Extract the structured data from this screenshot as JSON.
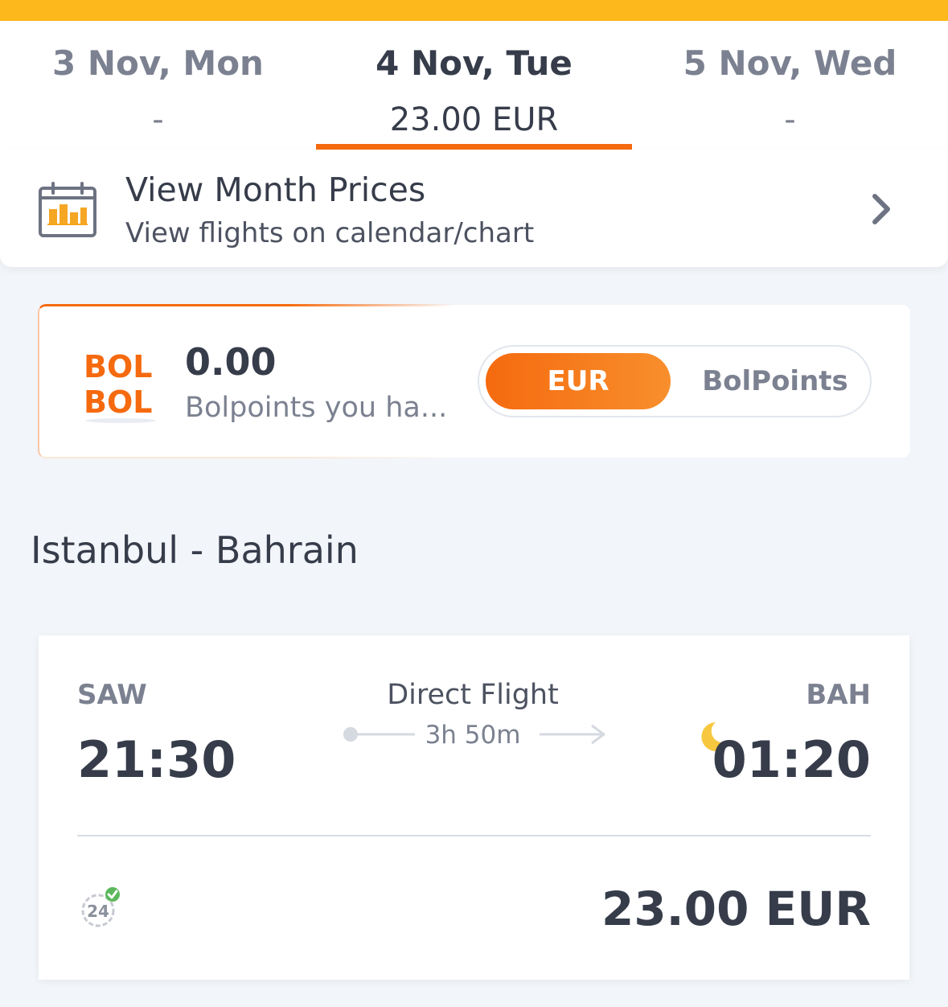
{
  "colors": {
    "accent_top": "#fdb81b",
    "accent_orange": "#f56a0f",
    "text_dark": "#363c4a",
    "text_muted": "#7b8190"
  },
  "date_tabs": [
    {
      "label": "3 Nov, Mon",
      "price": "-"
    },
    {
      "label": "4 Nov, Tue",
      "price": "23.00 EUR",
      "selected": true
    },
    {
      "label": "5 Nov, Wed",
      "price": "-"
    }
  ],
  "month_prices": {
    "title": "View Month Prices",
    "subtitle": "View flights on calendar/chart",
    "icon": "calendar-chart-icon",
    "chevron": "chevron-right-icon"
  },
  "bolpoints": {
    "logo_line1": "BOL",
    "logo_line2": "BOL",
    "amount": "0.00",
    "description": "Bolpoints you ha...",
    "toggle_options": [
      "EUR",
      "BolPoints"
    ],
    "selected_option": "EUR"
  },
  "route": {
    "title": "Istanbul - Bahrain"
  },
  "flight": {
    "departure_code": "SAW",
    "departure_time": "21:30",
    "arrival_code": "BAH",
    "arrival_time": "01:20",
    "flight_type": "Direct Flight",
    "duration": "3h 50m",
    "arrival_icon": "moon-icon",
    "badge_icon": "24-hour-check-icon",
    "badge_text": "24",
    "price": "23.00 EUR"
  }
}
